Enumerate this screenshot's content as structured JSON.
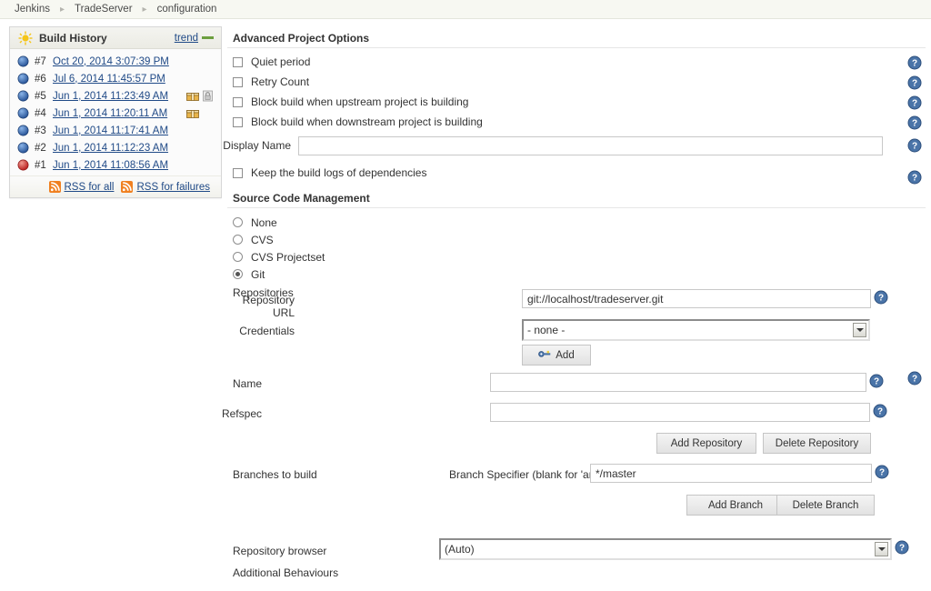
{
  "breadcrumb": {
    "items": [
      {
        "label": "Jenkins"
      },
      {
        "label": "TradeServer"
      },
      {
        "label": "configuration"
      }
    ],
    "separator": "▸"
  },
  "sidebar": {
    "build_history": {
      "title": "Build History",
      "weather_icon": "sun-icon",
      "trend_label": "trend",
      "builds": [
        {
          "number": "#7",
          "date": "Oct 20, 2014 3:07:39 PM",
          "status": "blue",
          "badges": []
        },
        {
          "number": "#6",
          "date": "Jul 6, 2014 11:45:57 PM",
          "status": "blue",
          "badges": []
        },
        {
          "number": "#5",
          "date": "Jun 1, 2014 11:23:49 AM",
          "status": "blue",
          "badges": [
            "package-icon",
            "lock-icon"
          ]
        },
        {
          "number": "#4",
          "date": "Jun 1, 2014 11:20:11 AM",
          "status": "blue",
          "badges": [
            "package-icon"
          ]
        },
        {
          "number": "#3",
          "date": "Jun 1, 2014 11:17:41 AM",
          "status": "blue",
          "badges": []
        },
        {
          "number": "#2",
          "date": "Jun 1, 2014 11:12:23 AM",
          "status": "blue",
          "badges": []
        },
        {
          "number": "#1",
          "date": "Jun 1, 2014 11:08:56 AM",
          "status": "red",
          "badges": []
        }
      ],
      "rss_all_label": "RSS for all",
      "rss_failures_label": "RSS for failures"
    }
  },
  "main": {
    "advanced": {
      "heading": "Advanced Project Options",
      "checkboxes": [
        {
          "label": "Quiet period",
          "checked": false
        },
        {
          "label": "Retry Count",
          "checked": false
        },
        {
          "label": "Block build when upstream project is building",
          "checked": false
        },
        {
          "label": "Block build when downstream project is building",
          "checked": false
        }
      ],
      "display_name": {
        "label": "Display Name",
        "value": "",
        "placeholder": ""
      },
      "keep_logs": {
        "label": "Keep the build logs of dependencies",
        "checked": false
      }
    },
    "scm": {
      "heading": "Source Code Management",
      "options": [
        {
          "label": "None",
          "selected": false
        },
        {
          "label": "CVS",
          "selected": false
        },
        {
          "label": "CVS Projectset",
          "selected": false
        },
        {
          "label": "Git",
          "selected": true
        }
      ],
      "repositories_label": "Repositories",
      "repository_url": {
        "label": "Repository URL",
        "value": "git://localhost/tradeserver.git",
        "placeholder": ""
      },
      "credentials": {
        "label": "Credentials",
        "value": "- none -",
        "options": [
          "- none -"
        ]
      },
      "credentials_add_label": "Add",
      "name": {
        "label": "Name",
        "value": "",
        "placeholder": ""
      },
      "refspec": {
        "label": "Refspec",
        "value": "",
        "placeholder": ""
      },
      "add_repository_label": "Add Repository",
      "delete_repository_label": "Delete Repository",
      "branches_label": "Branches to build",
      "branch_specifier": {
        "label": "Branch Specifier (blank for 'any')",
        "value": "*/master",
        "placeholder": ""
      },
      "add_branch_label": "Add Branch",
      "delete_branch_label": "Delete Branch",
      "repository_browser": {
        "label": "Repository browser",
        "value": "(Auto)",
        "options": [
          "(Auto)"
        ]
      },
      "additional_behaviours_label": "Additional Behaviours"
    }
  },
  "colors": {
    "link": "#204a87",
    "help_blue": "#3b6ea5",
    "ball_blue": "#3465a4",
    "ball_red": "#d03030",
    "rss_orange": "#f08020",
    "trend_green": "#6c9f3f"
  }
}
